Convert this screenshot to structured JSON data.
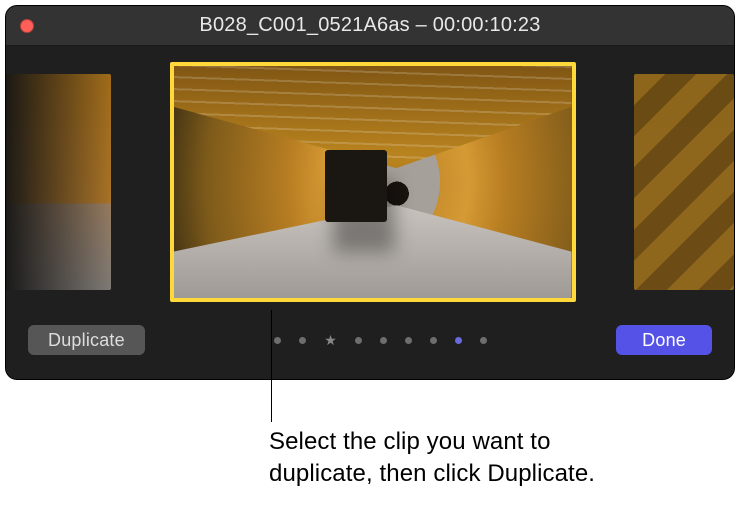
{
  "window": {
    "title": "B028_C001_0521A6as – 00:00:10:23",
    "close_color": "#ff5f57"
  },
  "buttons": {
    "duplicate": "Duplicate",
    "done": "Done",
    "done_color": "#5552e8"
  },
  "pager": {
    "count": 9,
    "favorite_index": 2,
    "active_index": 7
  },
  "callout": {
    "line1": "Select the clip you want to",
    "line2": "duplicate, then click Duplicate."
  },
  "selection": {
    "selected_border_color": "#ffd83a"
  }
}
